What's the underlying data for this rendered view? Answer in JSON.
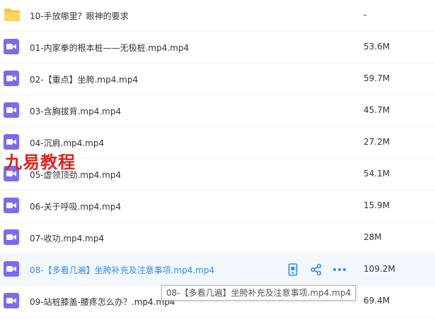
{
  "files": [
    {
      "name": "10-手放哪里？眼神的要求",
      "size": "-",
      "type": "folder"
    },
    {
      "name": "01-内家拳的根本桩——无极桩.mp4.mp4",
      "size": "53.6M",
      "type": "video"
    },
    {
      "name": "02-【重点】坐胯.mp4.mp4",
      "size": "59.7M",
      "type": "video"
    },
    {
      "name": "03-含胸拔背.mp4.mp4",
      "size": "45.7M",
      "type": "video"
    },
    {
      "name": "04-沉肩.mp4.mp4",
      "size": "27.2M",
      "type": "video"
    },
    {
      "name": "05-虚领顶劲.mp4.mp4",
      "size": "54.1M",
      "type": "video"
    },
    {
      "name": "06-关于呼吸.mp4.mp4",
      "size": "15.9M",
      "type": "video"
    },
    {
      "name": "07-收功.mp4.mp4",
      "size": "28M",
      "type": "video"
    },
    {
      "name": "08-【多看几遍】坐胯补充及注意事项.mp4.mp4",
      "size": "109.2M",
      "type": "video",
      "hovered": true
    },
    {
      "name": "09-站桩膝盖-腰疼怎么办？.mp4.mp4",
      "size": "69.4M",
      "type": "video"
    }
  ],
  "row_actions": [
    {
      "icon": "phone-icon"
    },
    {
      "icon": "share-icon"
    },
    {
      "icon": "more-icon"
    }
  ],
  "tooltip": "08-【多看几遍】坐胯补充及注意事项.mp4.mp4",
  "watermark": "九易教程",
  "colors": {
    "folder": "#f9c442",
    "video": "#7b6bf0",
    "accent": "#2f8cf0",
    "hover_bg": "#f3f8ff",
    "watermark": "#e2231a"
  }
}
